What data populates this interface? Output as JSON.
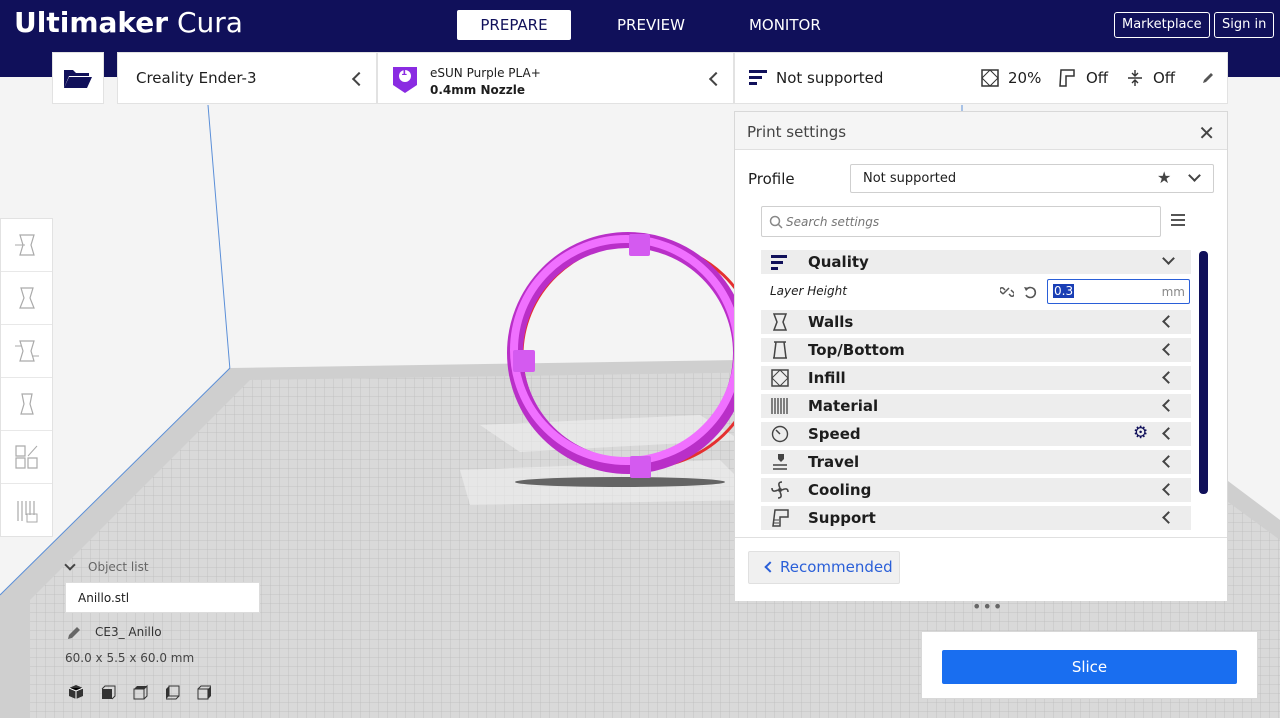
{
  "app": {
    "brand_bold": "Ultimaker",
    "brand_light": "Cura"
  },
  "stages": [
    {
      "label": "PREPARE",
      "active": true
    },
    {
      "label": "PREVIEW",
      "active": false
    },
    {
      "label": "MONITOR",
      "active": false
    }
  ],
  "header": {
    "marketplace": "Marketplace",
    "signin": "Sign in"
  },
  "printer": {
    "name": "Creality Ender-3"
  },
  "material": {
    "extruder": "1",
    "name": "eSUN Purple PLA+",
    "nozzle": "0.4mm Nozzle",
    "color": "#8a2be2"
  },
  "settings_bar": {
    "profile": "Not supported",
    "infill": "20%",
    "support": "Off",
    "adhesion": "Off"
  },
  "print_settings": {
    "title": "Print settings",
    "profile_label": "Profile",
    "profile_value": "Not supported",
    "search_placeholder": "Search settings",
    "categories": [
      {
        "label": "Quality",
        "icon": "quality-icon",
        "expanded": true
      },
      {
        "label": "Walls",
        "icon": "walls-icon"
      },
      {
        "label": "Top/Bottom",
        "icon": "top-bottom-icon"
      },
      {
        "label": "Infill",
        "icon": "infill-icon"
      },
      {
        "label": "Material",
        "icon": "material-icon"
      },
      {
        "label": "Speed",
        "icon": "speed-icon"
      },
      {
        "label": "Travel",
        "icon": "travel-icon"
      },
      {
        "label": "Cooling",
        "icon": "cooling-icon"
      },
      {
        "label": "Support",
        "icon": "support-icon"
      }
    ],
    "layer_height": {
      "label": "Layer Height",
      "value": "0.3",
      "unit": "mm"
    },
    "recommended": "Recommended"
  },
  "object_list": {
    "toggle": "Object list",
    "items": [
      "Anillo.stl"
    ],
    "job_name": "CE3_ Anillo",
    "dimensions": "60.0 x 5.5 x 60.0 mm"
  },
  "slice": {
    "label": "Slice"
  },
  "colors": {
    "header": "#10105a",
    "accent": "#196ef0",
    "model": "#e040f0"
  }
}
